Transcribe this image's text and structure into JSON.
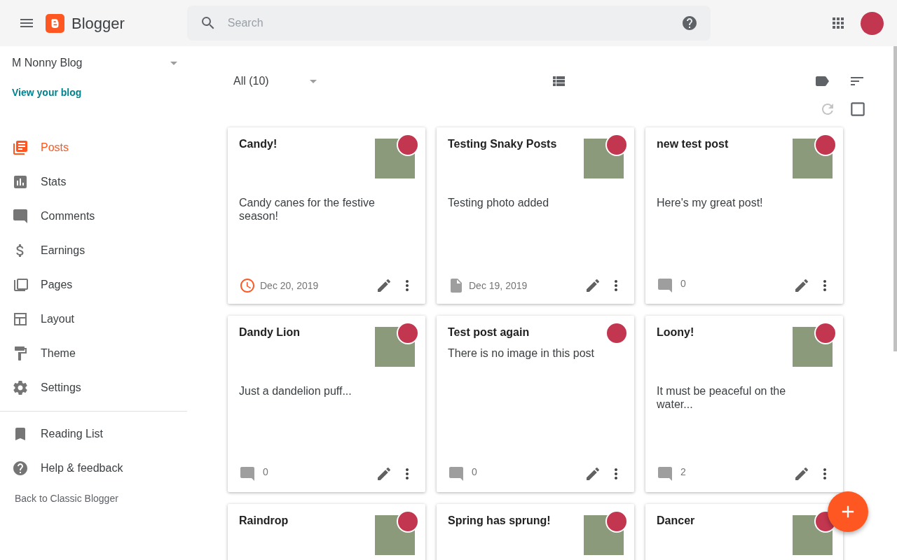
{
  "header": {
    "app_name": "Blogger",
    "search": {
      "placeholder": "Search"
    }
  },
  "sidebar": {
    "blog_name": "M Nonny Blog",
    "view_link": "View your blog",
    "items": [
      {
        "label": "Posts",
        "selected": true
      },
      {
        "label": "Stats",
        "selected": false
      },
      {
        "label": "Comments",
        "selected": false
      },
      {
        "label": "Earnings",
        "selected": false
      },
      {
        "label": "Pages",
        "selected": false
      },
      {
        "label": "Layout",
        "selected": false
      },
      {
        "label": "Theme",
        "selected": false
      },
      {
        "label": "Settings",
        "selected": false
      }
    ],
    "secondary_items": [
      {
        "label": "Reading List"
      },
      {
        "label": "Help & feedback"
      }
    ],
    "classic_link": "Back to Classic Blogger"
  },
  "filter": {
    "value": "All (10)"
  },
  "posts": [
    {
      "title": "Candy!",
      "has_image": true,
      "description": "Candy canes for the festive season!",
      "footer": {
        "kind": "scheduled",
        "text": "Dec 20, 2019"
      }
    },
    {
      "title": "Testing Snaky Posts",
      "has_image": true,
      "description": "Testing photo added",
      "footer": {
        "kind": "draft",
        "text": "Dec 19, 2019"
      }
    },
    {
      "title": "new test post",
      "has_image": true,
      "description": "Here's my great post!",
      "footer": {
        "kind": "published",
        "text": "0"
      }
    },
    {
      "title": "Dandy Lion",
      "has_image": true,
      "description": "Just a dandelion puff...",
      "footer": {
        "kind": "published",
        "text": "0"
      }
    },
    {
      "title": "Test post again",
      "has_image": false,
      "description": "There is no image in this post",
      "footer": {
        "kind": "published",
        "text": "0"
      }
    },
    {
      "title": "Loony!",
      "has_image": true,
      "description": "It must be peaceful on the water...",
      "footer": {
        "kind": "published",
        "text": "2"
      }
    },
    {
      "title": "Raindrop",
      "has_image": true
    },
    {
      "title": "Spring has sprung!",
      "has_image": true
    },
    {
      "title": "Dancer",
      "has_image": true
    }
  ]
}
